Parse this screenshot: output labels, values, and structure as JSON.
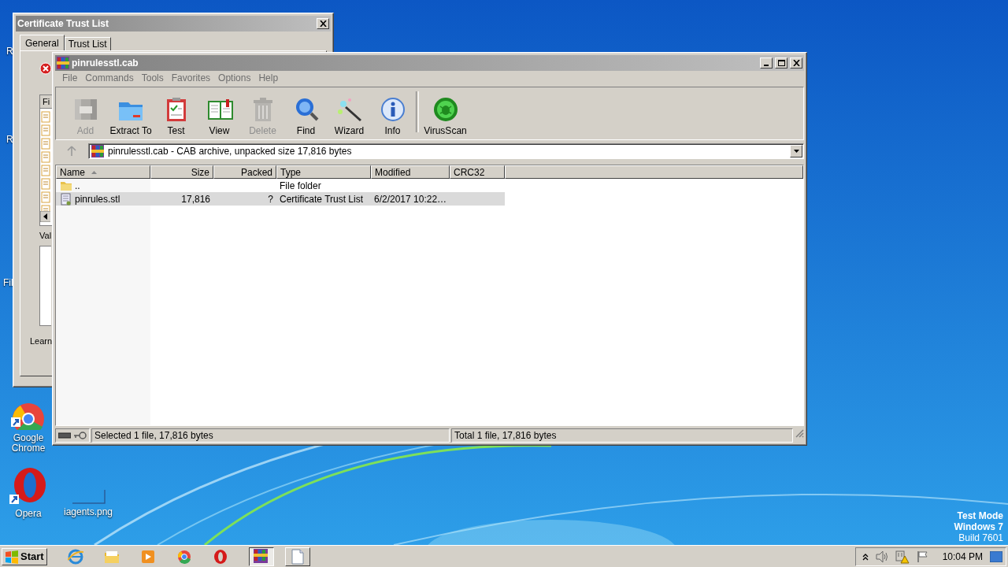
{
  "desktop": {
    "icons": [
      {
        "label": "R"
      },
      {
        "label": "R"
      },
      {
        "label": "Fil"
      },
      {
        "label": "Google Chrome"
      },
      {
        "label": "Opera"
      },
      {
        "label": "iagents.png"
      }
    ],
    "os_notice": [
      "Test Mode",
      "Windows 7",
      "Build 7601"
    ]
  },
  "cert_dialog": {
    "title": "Certificate Trust List",
    "tabs": [
      {
        "label": "General",
        "selected": true
      },
      {
        "label": "Trust List",
        "selected": false
      }
    ],
    "list_header": "Fi",
    "value_label": "Val",
    "link": "Learn"
  },
  "winrar": {
    "title": "pinrulesstl.cab",
    "menu": [
      "File",
      "Commands",
      "Tools",
      "Favorites",
      "Options",
      "Help"
    ],
    "toolbar": [
      {
        "label": "Add",
        "disabled": true
      },
      {
        "label": "Extract To",
        "disabled": false
      },
      {
        "label": "Test",
        "disabled": false
      },
      {
        "label": "View",
        "disabled": false
      },
      {
        "label": "Delete",
        "disabled": true
      },
      {
        "label": "Find",
        "disabled": false
      },
      {
        "label": "Wizard",
        "disabled": false
      },
      {
        "label": "Info",
        "disabled": false
      },
      {
        "label": "VirusScan",
        "disabled": false
      }
    ],
    "address": "pinrulesstl.cab - CAB archive, unpacked size 17,816 bytes",
    "columns": [
      "Name",
      "Size",
      "Packed",
      "Type",
      "Modified",
      "CRC32"
    ],
    "rows": [
      {
        "kind": "folder",
        "name": "..",
        "type": "File folder",
        "selected": false
      },
      {
        "kind": "file",
        "name": "pinrules.stl",
        "size": "17,816",
        "packed": "?",
        "type": "Certificate Trust List",
        "modified": "6/2/2017 10:22…",
        "selected": true
      }
    ],
    "status": [
      "Selected 1 file, 17,816 bytes",
      "Total 1 file, 17,816 bytes"
    ]
  },
  "taskbar": {
    "start": "Start",
    "apps": [
      {
        "active": false
      },
      {
        "active": false
      },
      {
        "active": false
      },
      {
        "active": false
      },
      {
        "active": false
      },
      {
        "active": true
      },
      {
        "active": false
      }
    ],
    "clock": "10:04 PM"
  }
}
